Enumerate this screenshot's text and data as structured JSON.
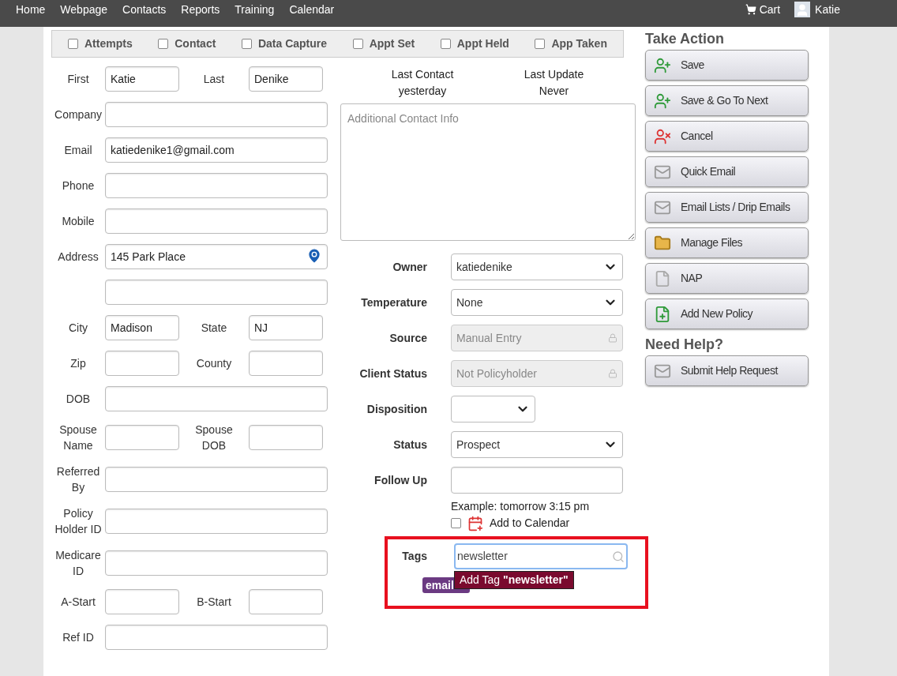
{
  "nav": {
    "items": [
      {
        "label": "Home"
      },
      {
        "label": "Webpage"
      },
      {
        "label": "Contacts"
      },
      {
        "label": "Reports"
      },
      {
        "label": "Training"
      },
      {
        "label": "Calendar"
      }
    ],
    "cart": "Cart",
    "user": "Katie"
  },
  "stage_checks": [
    {
      "label": "Attempts",
      "checked": false
    },
    {
      "label": "Contact",
      "checked": false
    },
    {
      "label": "Data Capture",
      "checked": false
    },
    {
      "label": "Appt Set",
      "checked": false
    },
    {
      "label": "Appt Held",
      "checked": false
    },
    {
      "label": "App Taken",
      "checked": false
    }
  ],
  "contact_rows": [
    {
      "fields": [
        {
          "label": "First",
          "value": "Katie",
          "kind": "text"
        },
        {
          "label": "Last",
          "value": "Denike",
          "kind": "text"
        }
      ]
    },
    {
      "fields": [
        {
          "label": "Company",
          "kind": "text"
        }
      ]
    },
    {
      "fields": [
        {
          "label": "Email",
          "value": "katiedenike1@gmail.com",
          "kind": "text"
        }
      ]
    },
    {
      "fields": [
        {
          "label": "Phone",
          "kind": "text"
        }
      ]
    },
    {
      "fields": [
        {
          "label": "Mobile",
          "kind": "text"
        }
      ]
    },
    {
      "fields": [
        {
          "label": "Address",
          "value": "145 Park Place",
          "kind": "location"
        }
      ]
    },
    {
      "fields": [
        {
          "kind": "text"
        }
      ]
    },
    {
      "fields": [
        {
          "label": "City",
          "value": "Madison",
          "kind": "text"
        },
        {
          "label": "State",
          "value": "NJ",
          "kind": "text"
        }
      ]
    },
    {
      "fields": [
        {
          "label": "Zip",
          "kind": "text"
        },
        {
          "label": "County",
          "kind": "text"
        }
      ]
    },
    {
      "fields": [
        {
          "label": "DOB",
          "kind": "text"
        }
      ]
    },
    {
      "fields": [
        {
          "label": "Spouse Name",
          "kind": "text"
        },
        {
          "label": "Spouse DOB",
          "kind": "text"
        }
      ]
    },
    {
      "fields": [
        {
          "label": "Referred By",
          "kind": "text"
        }
      ]
    },
    {
      "fields": [
        {
          "label": "Policy Holder ID",
          "kind": "text"
        }
      ]
    },
    {
      "fields": [
        {
          "label": "Medicare ID",
          "kind": "text"
        }
      ]
    },
    {
      "fields": [
        {
          "label": "A-Start",
          "kind": "text"
        },
        {
          "label": "B-Start",
          "kind": "text"
        }
      ]
    },
    {
      "fields": [
        {
          "label": "Ref ID",
          "kind": "text"
        }
      ]
    }
  ],
  "last_contact": {
    "label": "Last Contact",
    "value": "yesterday"
  },
  "last_update": {
    "label": "Last Update",
    "value": "Never"
  },
  "notes": {
    "placeholder": "Additional Contact Info"
  },
  "details": [
    {
      "label": "Owner",
      "kind": "select",
      "value": "katiedenike"
    },
    {
      "label": "Temperature",
      "kind": "select",
      "value": "None"
    },
    {
      "label": "Source",
      "kind": "locked",
      "value": "Manual Entry"
    },
    {
      "label": "Client Status",
      "kind": "locked",
      "value": "Not Policyholder"
    },
    {
      "label": "Disposition",
      "kind": "select_short"
    },
    {
      "label": "Status",
      "kind": "select",
      "value": "Prospect"
    },
    {
      "label": "Follow Up",
      "kind": "input"
    }
  ],
  "follow_up_hint": "Example: tomorrow 3:15 pm",
  "add_to_calendar": {
    "label": "Add to Calendar",
    "checked": false
  },
  "tags": {
    "label": "Tags",
    "value": "newsletter",
    "suggestion": "Add Tag **\"newsletter\"**",
    "highlighted": true,
    "items": [
      {
        "label": "email"
      }
    ]
  },
  "take_action": {
    "title": "Take Action",
    "buttons": [
      {
        "label": "Save",
        "kind": "person_add"
      },
      {
        "label": "Save & Go To Next",
        "kind": "person_add"
      },
      {
        "label": "Cancel",
        "kind": "person_remove"
      },
      {
        "label": "Quick Email",
        "kind": "envelope"
      },
      {
        "label": "Email Lists / Drip Emails",
        "kind": "envelope"
      },
      {
        "label": "Manage Files",
        "kind": "folder"
      },
      {
        "label": "NAP",
        "kind": "document"
      },
      {
        "label": "Add New Policy",
        "kind": "document_add"
      }
    ]
  },
  "need_help": {
    "title": "Need Help?",
    "buttons": [
      {
        "label": "Submit Help Request",
        "kind": "envelope"
      }
    ]
  }
}
